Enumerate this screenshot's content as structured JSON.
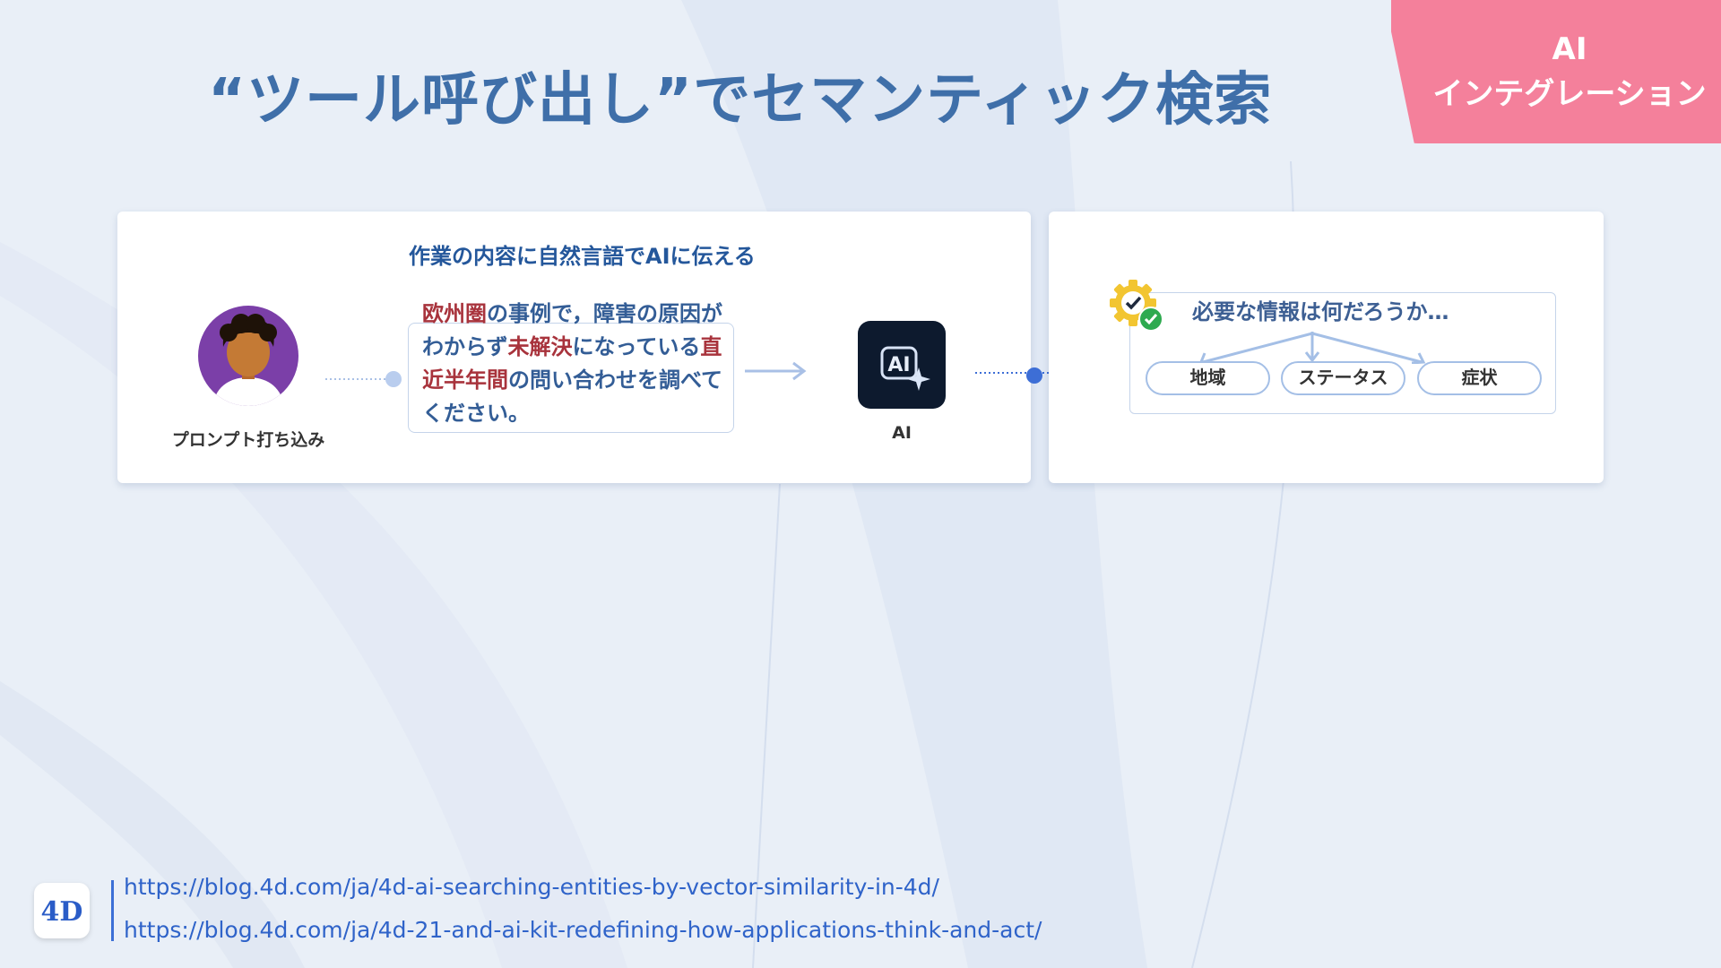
{
  "slide": {
    "title": "“ツール呼び出し”でセマンティック検索",
    "corner_badge": {
      "line1": "AI",
      "line2": "インテグレーション",
      "color": "#f4809b"
    }
  },
  "left_panel": {
    "heading": "作業の内容に自然言語でAIに伝える",
    "user_label": "プロンプト打ち込み",
    "prompt_segments": [
      {
        "text": "欧州圏",
        "highlight": true
      },
      {
        "text": "の事例で，障害の原因がわからず",
        "highlight": false
      },
      {
        "text": "未解決",
        "highlight": true
      },
      {
        "text": "になっている",
        "highlight": false
      },
      {
        "text": "直近半年間",
        "highlight": true
      },
      {
        "text": "の問い合わせを調べてください。",
        "highlight": false
      }
    ],
    "ai_label": "AI",
    "ai_icon_text": "AI",
    "ai_icon": "ai-sparkle-icon"
  },
  "right_panel": {
    "question": "必要な情報は何だろうか…",
    "icon": "gear-check-icon",
    "parameters": [
      "地域",
      "ステータス",
      "症状"
    ]
  },
  "footer": {
    "logo": "4D",
    "links": [
      "https://blog.4d.com/ja/4d-ai-searching-entities-by-vector-similarity-in-4d/",
      "https://blog.4d.com/ja/4d-21-and-ai-kit-redefining-how-applications-think-and-act/"
    ]
  },
  "colors": {
    "title": "#3f6fa9",
    "highlight": "#a8333c",
    "accent": "#3b6fd6"
  }
}
